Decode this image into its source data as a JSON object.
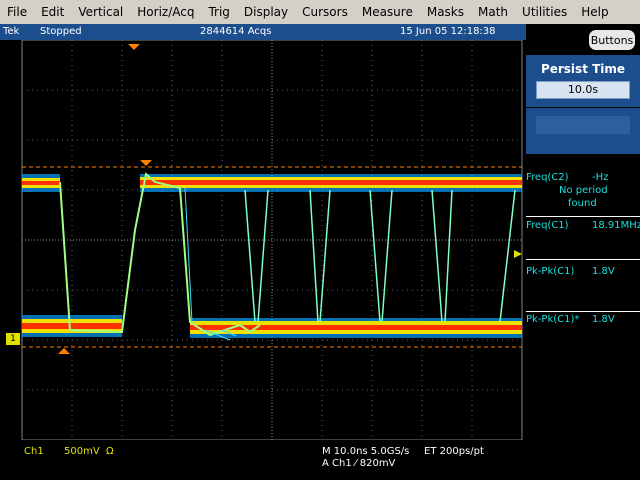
{
  "menu": [
    "File",
    "Edit",
    "Vertical",
    "Horiz/Acq",
    "Trig",
    "Display",
    "Cursors",
    "Measure",
    "Masks",
    "Math",
    "Utilities",
    "Help"
  ],
  "status": {
    "brand": "Tek",
    "state": "Stopped",
    "acqs": "2844614 Acqs",
    "datetime": "15 Jun 05 12:18:38"
  },
  "buttons_label": "Buttons",
  "persist": {
    "title": "Persist Time",
    "value": "10.0s"
  },
  "measurements": [
    {
      "label": "Freq(C2)",
      "value": "-Hz",
      "note1": "No period",
      "note2": "found"
    },
    {
      "label": "Freq(C1)",
      "value": "18.91MHz"
    },
    {
      "label": "Pk-Pk(C1)",
      "value": "1.8V"
    },
    {
      "label": "Pk-Pk(C1)*",
      "value": "1.8V"
    }
  ],
  "channel": {
    "name": "Ch1",
    "scale": "500mV",
    "coupling": "Ω",
    "marker": "1"
  },
  "timebase": {
    "line1": "M 10.0ns 5.0GS/s",
    "sampling": "ET 200ps/pt",
    "trigger": "A  Ch1  ⁄  820mV"
  },
  "colors": {
    "menubar": "#d4d0c8",
    "status_bg": "#1c4d8c",
    "measurement_text": "#19e0e0",
    "channel_text": "#e0e000",
    "trace_hot": "#ff2000",
    "trace_cool": "#00c0ff",
    "marker_orange": "#ff8000"
  }
}
